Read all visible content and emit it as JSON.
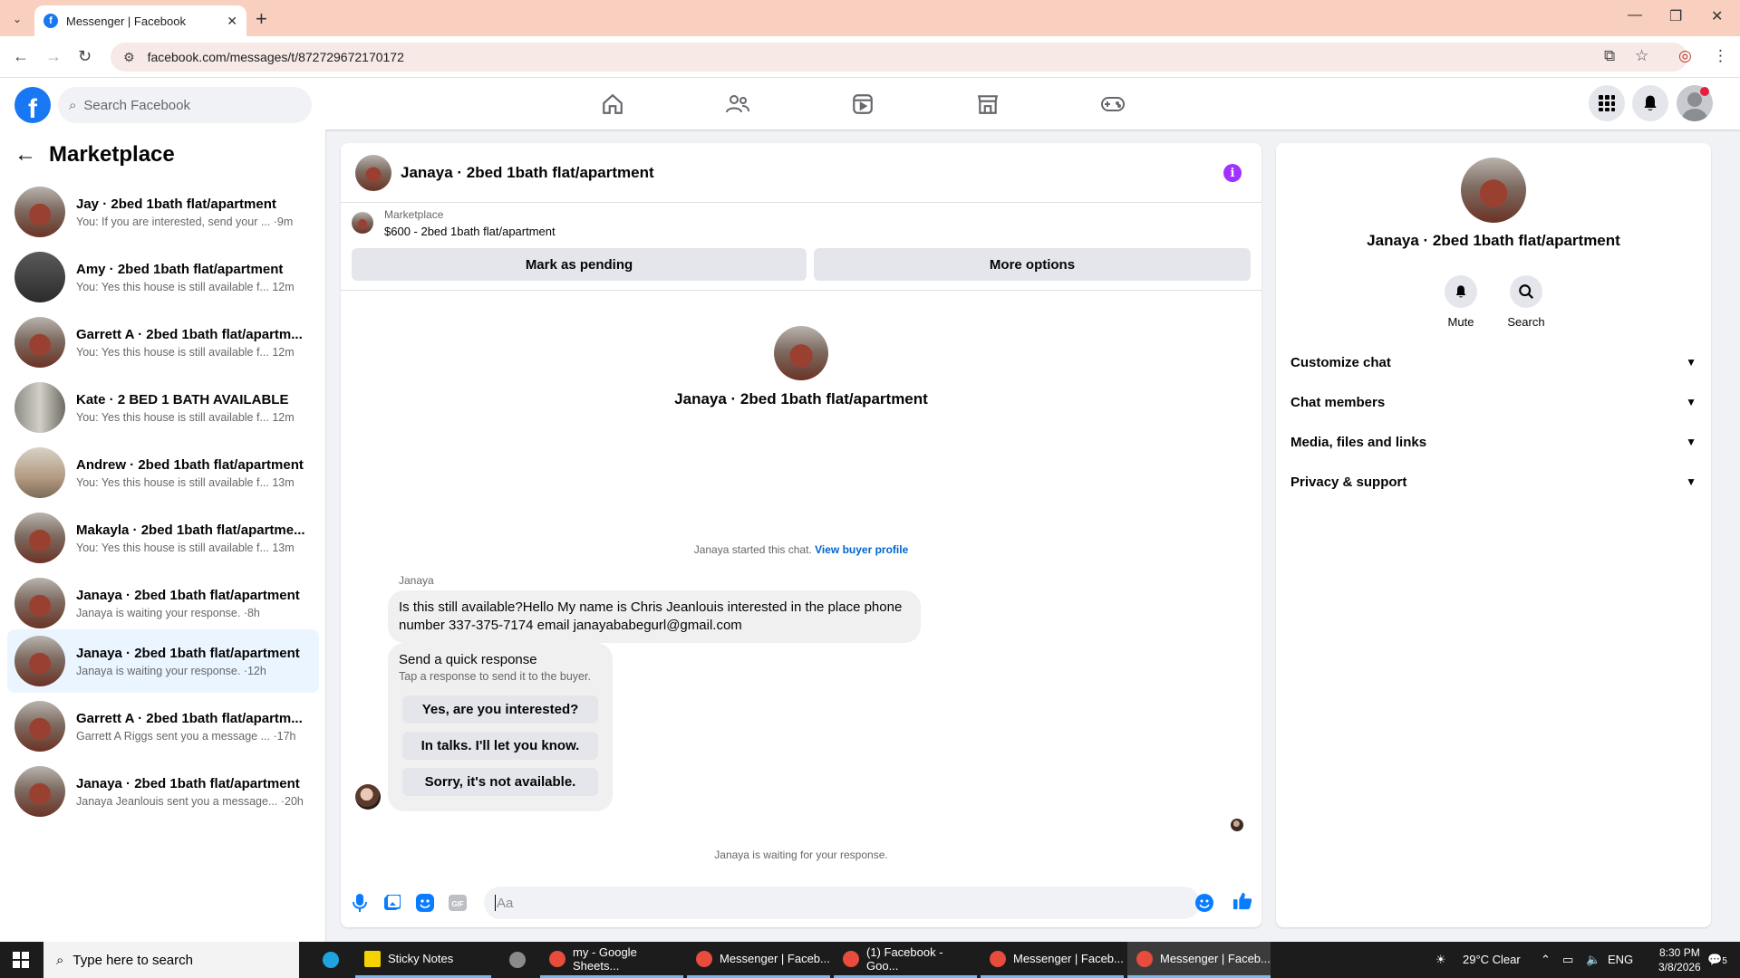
{
  "browser": {
    "tab_title": "Messenger | Facebook",
    "url": "facebook.com/messages/t/872729672170172"
  },
  "fb": {
    "search_placeholder": "Search Facebook"
  },
  "sidebar": {
    "title": "Marketplace",
    "conversations": [
      {
        "name": "Jay · 2bed 1bath flat/apartment",
        "preview": "You: If you are interested, send your ... ·9m"
      },
      {
        "name": "Amy · 2bed 1bath flat/apartment",
        "preview": "You: Yes this house is still available f... 12m"
      },
      {
        "name": "Garrett A · 2bed 1bath flat/apartm...",
        "preview": "You: Yes this house is still available f... 12m"
      },
      {
        "name": "Kate · 2 BED 1 BATH AVAILABLE",
        "preview": "You: Yes this house is still available f... 12m"
      },
      {
        "name": "Andrew · 2bed 1bath flat/apartment",
        "preview": "You: Yes this house is still available f... 13m"
      },
      {
        "name": "Makayla · 2bed 1bath flat/apartme...",
        "preview": "You: Yes this house is still available f... 13m"
      },
      {
        "name": "Janaya · 2bed 1bath flat/apartment",
        "preview": "Janaya is waiting your response. ·8h"
      },
      {
        "name": "Janaya · 2bed 1bath flat/apartment",
        "preview": "Janaya is waiting your response. ·12h"
      },
      {
        "name": "Garrett A · 2bed 1bath flat/apartm...",
        "preview": "Garrett A Riggs sent you a message ... ·17h"
      },
      {
        "name": "Janaya · 2bed 1bath flat/apartment",
        "preview": "Janaya Jeanlouis sent you a message... ·20h"
      }
    ]
  },
  "chat": {
    "title": "Janaya · 2bed 1bath flat/apartment",
    "listing_source": "Marketplace",
    "listing_title": "$600 - 2bed 1bath flat/apartment",
    "mark_pending_label": "Mark as pending",
    "more_options_label": "More options",
    "center_name": "Janaya · 2bed 1bath flat/apartment",
    "started_text": "Janaya started this chat.",
    "view_buyer_profile": "View buyer profile",
    "sender": "Janaya",
    "message": "Is this still available?Hello My name is Chris Jeanlouis interested in  the place phone number 337-375-7174 email janayababegurl@gmail.com",
    "quick_title": "Send a quick response",
    "quick_subtitle": "Tap a response to send it to the buyer.",
    "quick_replies": [
      "Yes, are you interested?",
      "In talks. I'll let you know.",
      "Sorry, it's not available."
    ],
    "waiting_text": "Janaya is waiting for your response.",
    "composer_placeholder": "Aa"
  },
  "rpanel": {
    "name": "Janaya · 2bed 1bath flat/apartment",
    "mute_label": "Mute",
    "search_label": "Search",
    "sections": [
      "Customize chat",
      "Chat members",
      "Media, files and links",
      "Privacy & support"
    ]
  },
  "taskbar": {
    "search_placeholder": "Type here to search",
    "items": [
      "Sticky Notes",
      "my - Google Sheets...",
      "Messenger | Faceb...",
      "(1) Facebook - Goo...",
      "Messenger | Faceb...",
      "Messenger | Faceb..."
    ],
    "weather": "29°C  Clear",
    "lang": "ENG",
    "time": "8:30 PM",
    "date": "3/8/2026",
    "notif_count": "5"
  },
  "colors": {
    "fb_blue": "#1877f2",
    "messenger_blue": "#0a7cff",
    "active_conv_bg": "#ebf5ff",
    "tabbar_bg": "#f9cfc0"
  }
}
